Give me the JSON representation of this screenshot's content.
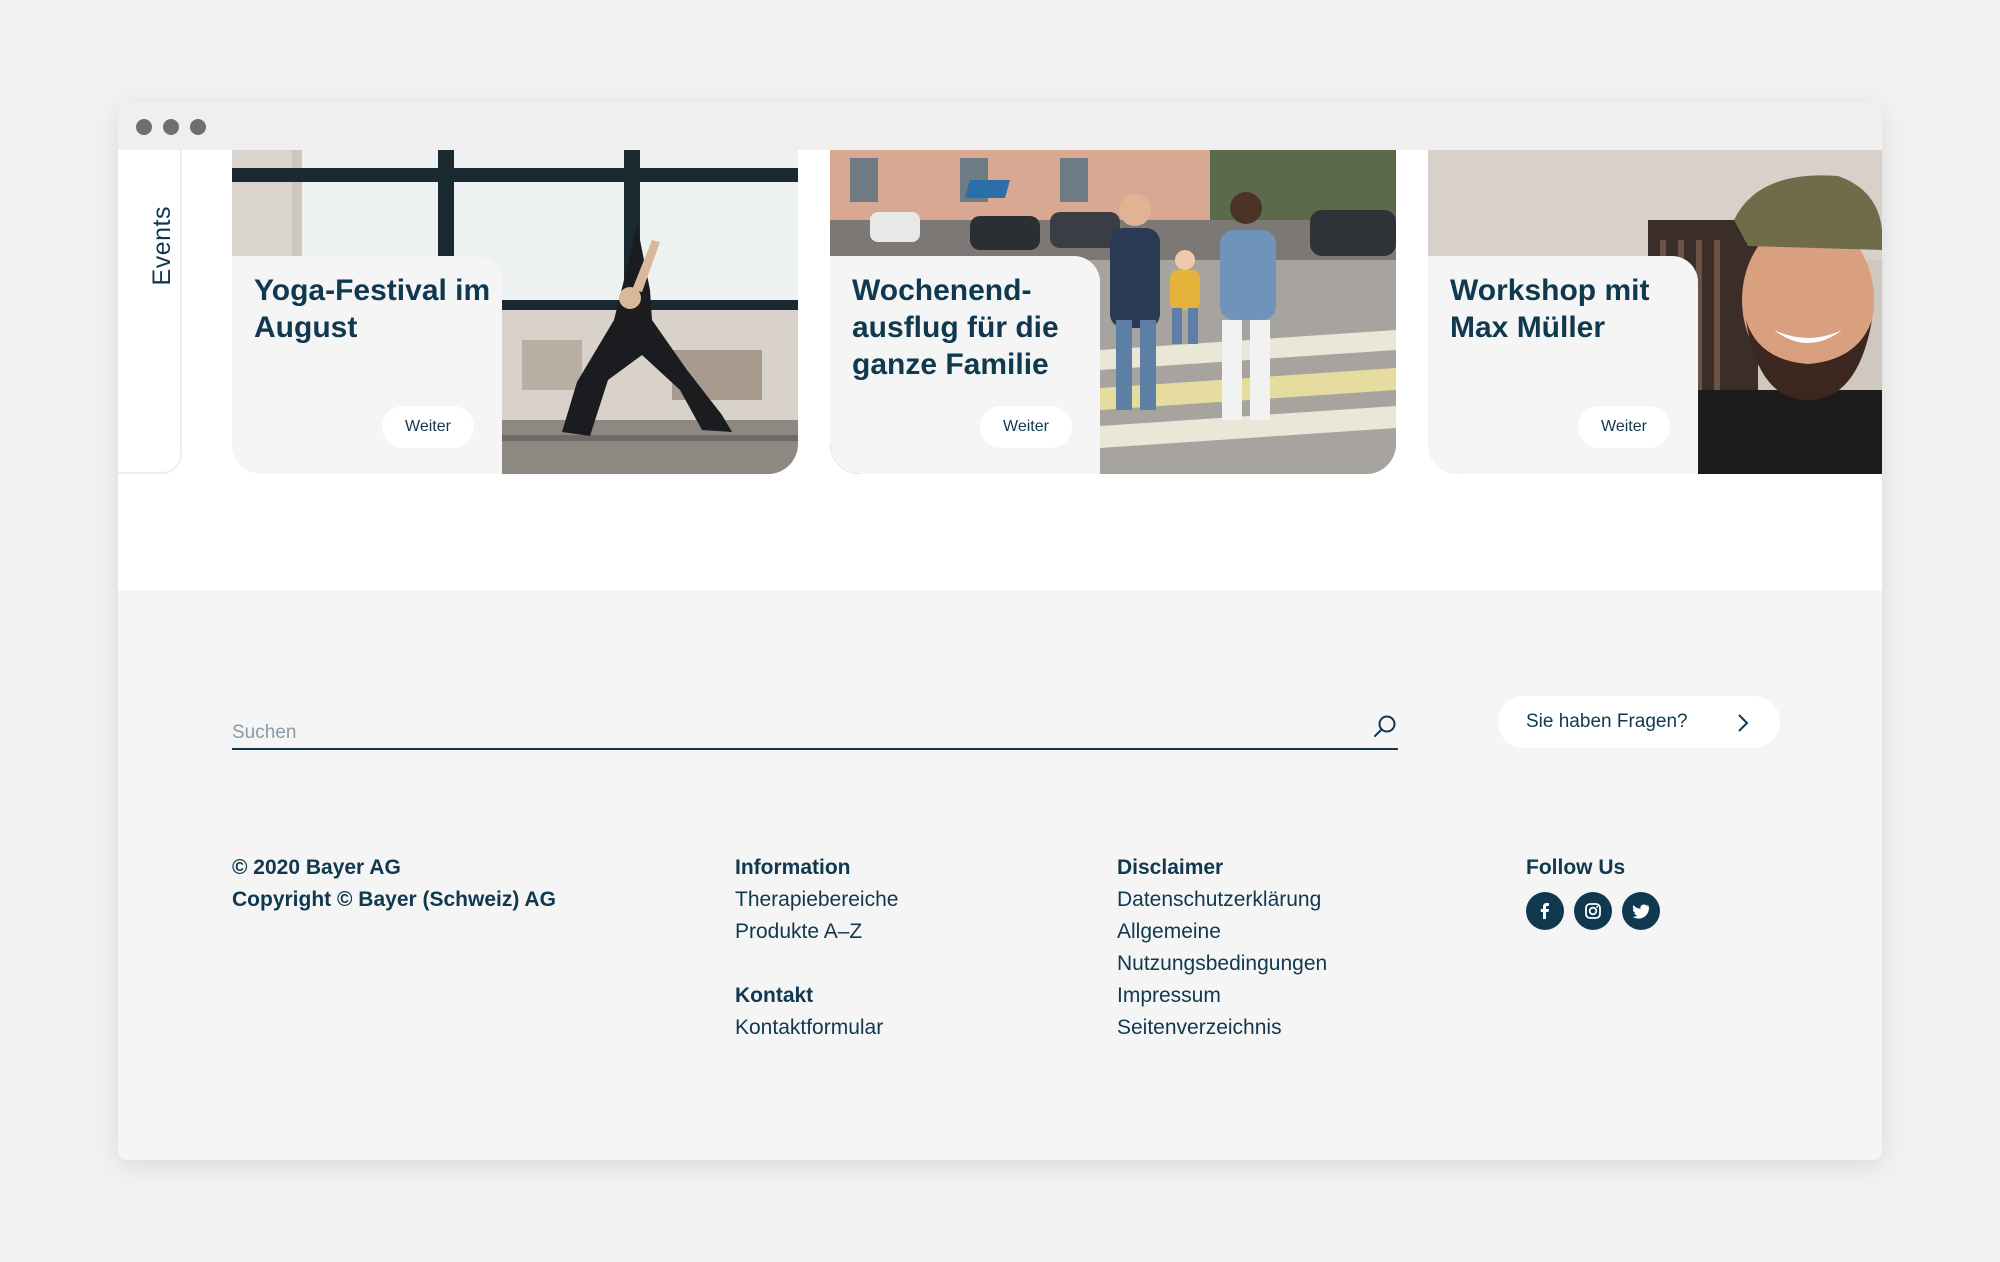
{
  "sidebar": {
    "events_label": "Events"
  },
  "cards": [
    {
      "title": "Yoga-Festival im August",
      "button": "Weiter"
    },
    {
      "title": "Wochenend-ausflug für die ganze Familie",
      "button": "Weiter"
    },
    {
      "title": "Workshop mit Max Müller",
      "button": "Weiter"
    }
  ],
  "footer": {
    "search": {
      "placeholder": "Suchen",
      "value": ""
    },
    "faq_button": "Sie haben Fragen?",
    "copyright": [
      "© 2020 Bayer AG",
      "Copyright © Bayer (Schweiz) AG"
    ],
    "information": {
      "heading": "Information",
      "links": [
        "Therapiebereiche",
        "Produkte A–Z"
      ]
    },
    "kontakt": {
      "heading": "Kontakt",
      "links": [
        "Kontaktformular"
      ]
    },
    "disclaimer": {
      "heading": "Disclaimer",
      "links": [
        "Datenschutzerklärung",
        "Allgemeine",
        "Nutzungsbedingungen",
        "Impressum",
        "Seitenverzeichnis"
      ]
    },
    "follow": {
      "heading": "Follow Us",
      "icons": [
        "facebook-icon",
        "instagram-icon",
        "twitter-icon"
      ]
    }
  },
  "colors": {
    "primary": "#10384f",
    "footer_bg": "#f5f5f5",
    "page_bg": "#f2f2f2"
  }
}
